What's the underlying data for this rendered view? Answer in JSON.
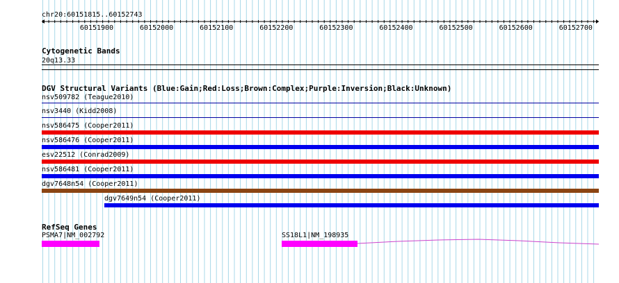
{
  "ruler": {
    "location": "chr20:60151815..60152743",
    "tick_labels": [
      "60151900",
      "60152000",
      "60152100",
      "60152200",
      "60152300",
      "60152400",
      "60152500",
      "60152600",
      "60152700"
    ]
  },
  "cytoband": {
    "title": "Cytogenetic Bands",
    "band": "20q13.33"
  },
  "dgv": {
    "title": "DGV Structural Variants (Blue:Gain;Red:Loss;Brown:Complex;Purple:Inversion;Black:Unknown)",
    "features": [
      {
        "label": "nsv509782 (Teague2010)",
        "type": "line",
        "color": "#0000a0"
      },
      {
        "label": "nsv3440 (Kidd2008)",
        "type": "line",
        "color": "#0000a0"
      },
      {
        "label": "nsv586475 (Cooper2011)",
        "type": "bar",
        "color": "#ee0000"
      },
      {
        "label": "nsv586476 (Cooper2011)",
        "type": "bar",
        "color": "#0000ee"
      },
      {
        "label": "esv22512 (Conrad2009)",
        "type": "bar",
        "color": "#ee0000"
      },
      {
        "label": "nsv586481 (Cooper2011)",
        "type": "bar",
        "color": "#0000ee"
      },
      {
        "label": "dgv7648n54 (Cooper2011)",
        "type": "bar",
        "color": "#8b4513"
      },
      {
        "label": "dgv7649n54 (Cooper2011)",
        "type": "bar",
        "color": "#0000ee"
      }
    ]
  },
  "refseq": {
    "title": "RefSeq Genes",
    "genes": [
      {
        "label": "PSMA7|NM_002792",
        "color": "#ff00ff"
      },
      {
        "label": "SS18L1|NM_198935",
        "color": "#ff00ff"
      }
    ]
  },
  "colors": {
    "grid_line": "#a8d8e8",
    "ruler": "#000000",
    "gene": "#ff00ff",
    "intron": "#cc44cc"
  }
}
